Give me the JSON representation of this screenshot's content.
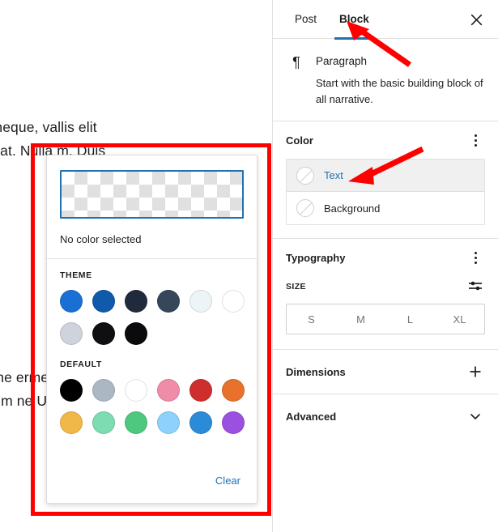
{
  "editor": {
    "paragraph_1": "a velit neque, vallis elit viverra at. Nulla m. Duis ",
    "paragraph_2": "eugiat ne ermentu tique po entum ne Ut rhon bero."
  },
  "sidebar": {
    "tabs": [
      {
        "label": "Post",
        "active": false
      },
      {
        "label": "Block",
        "active": true
      }
    ],
    "close_icon": "close-icon",
    "block_card": {
      "icon": "paragraph-pilcrow-icon",
      "icon_glyph": "¶",
      "title": "Paragraph",
      "description": "Start with the basic building block of all narrative."
    },
    "color_panel": {
      "title": "Color",
      "menu_icon": "ellipsis-vertical-icon",
      "rows": [
        {
          "label": "Text",
          "selected": true,
          "indicator": "no-color-circle-icon"
        },
        {
          "label": "Background",
          "selected": false,
          "indicator": "no-color-circle-icon"
        }
      ]
    },
    "typography_panel": {
      "title": "Typography",
      "menu_icon": "ellipsis-vertical-icon",
      "size_label": "SIZE",
      "settings_icon": "sliders-icon",
      "sizes": [
        "S",
        "M",
        "L",
        "XL"
      ],
      "selected_size": null
    },
    "dimensions_panel": {
      "title": "Dimensions",
      "action_icon": "plus-icon"
    },
    "advanced_panel": {
      "title": "Advanced",
      "action_icon": "chevron-down-icon"
    }
  },
  "color_picker": {
    "preview_state": "transparent-checkerboard",
    "status_text": "No color selected",
    "theme": {
      "label": "THEME",
      "swatches": [
        {
          "name": "theme-blue-bright",
          "hex": "#1a6fd4"
        },
        {
          "name": "theme-blue-dark",
          "hex": "#1159ab"
        },
        {
          "name": "theme-navy",
          "hex": "#21293c"
        },
        {
          "name": "theme-slate",
          "hex": "#36475c"
        },
        {
          "name": "theme-pale-blue",
          "hex": "#edf4f8"
        },
        {
          "name": "theme-white",
          "hex": "#ffffff"
        },
        {
          "name": "theme-light-gray",
          "hex": "#ced3dc"
        },
        {
          "name": "theme-black-1",
          "hex": "#0f0f12"
        },
        {
          "name": "theme-black-2",
          "hex": "#0b0b0d"
        }
      ]
    },
    "default": {
      "label": "DEFAULT",
      "swatches": [
        {
          "name": "default-black",
          "hex": "#000000"
        },
        {
          "name": "default-cyan-gray",
          "hex": "#abb8c3"
        },
        {
          "name": "default-white",
          "hex": "#ffffff"
        },
        {
          "name": "default-pink",
          "hex": "#f08ca8"
        },
        {
          "name": "default-red",
          "hex": "#cf2e2e"
        },
        {
          "name": "default-orange",
          "hex": "#e8722c"
        },
        {
          "name": "default-amber",
          "hex": "#f0b849"
        },
        {
          "name": "default-light-green",
          "hex": "#7ddcb1"
        },
        {
          "name": "default-green",
          "hex": "#4ec77f"
        },
        {
          "name": "default-light-blue",
          "hex": "#8ed1fc"
        },
        {
          "name": "default-blue",
          "hex": "#2a8bd8"
        },
        {
          "name": "default-purple",
          "hex": "#9b51e0"
        }
      ]
    },
    "clear_label": "Clear"
  },
  "annotations": {
    "highlight_color": "#ff0000",
    "box_target": "color-picker-popover",
    "arrow_1_target": "tab-block",
    "arrow_2_target": "color-row-text"
  }
}
